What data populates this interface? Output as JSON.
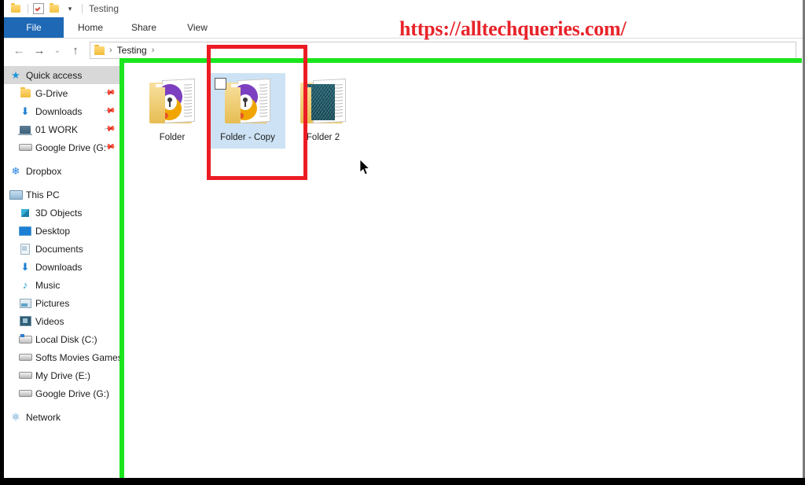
{
  "window": {
    "title": "Testing",
    "quick_access_toolbar": [
      {
        "name": "properties-folder-icon",
        "label": ""
      },
      {
        "name": "properties-checkbox-icon",
        "label": ""
      },
      {
        "name": "new-folder-icon",
        "label": ""
      },
      {
        "name": "customize-qat-caret",
        "label": "▾"
      }
    ]
  },
  "ribbon": {
    "tabs": [
      {
        "label": "File",
        "active": true
      },
      {
        "label": "Home",
        "active": false
      },
      {
        "label": "Share",
        "active": false
      },
      {
        "label": "View",
        "active": false
      }
    ]
  },
  "navigation": {
    "back_glyph": "←",
    "forward_glyph": "→",
    "recent_glyph": "⌄",
    "up_glyph": "↑",
    "breadcrumb": {
      "separator": "›",
      "leading_separator": "›",
      "crumbs": [
        "Testing"
      ]
    }
  },
  "sidebar": {
    "groups": [
      {
        "items": [
          {
            "label": "Quick access",
            "icon": "star-icon",
            "selected": true,
            "pinned": false,
            "indent": 0
          },
          {
            "label": "G-Drive",
            "icon": "folder-icon",
            "selected": false,
            "pinned": true,
            "indent": 1
          },
          {
            "label": "Downloads",
            "icon": "download-icon",
            "selected": false,
            "pinned": true,
            "indent": 1
          },
          {
            "label": "01 WORK",
            "icon": "laptop-icon",
            "selected": false,
            "pinned": true,
            "indent": 1
          },
          {
            "label": "Google Drive (G:",
            "icon": "drive-icon",
            "selected": false,
            "pinned": true,
            "indent": 1
          }
        ]
      },
      {
        "items": [
          {
            "label": "Dropbox",
            "icon": "dropbox-icon",
            "selected": false,
            "pinned": false,
            "indent": 0
          }
        ]
      },
      {
        "items": [
          {
            "label": "This PC",
            "icon": "this-pc-icon",
            "selected": false,
            "pinned": false,
            "indent": 0
          },
          {
            "label": "3D Objects",
            "icon": "3d-objects-icon",
            "selected": false,
            "pinned": false,
            "indent": 1
          },
          {
            "label": "Desktop",
            "icon": "desktop-icon",
            "selected": false,
            "pinned": false,
            "indent": 1
          },
          {
            "label": "Documents",
            "icon": "documents-icon",
            "selected": false,
            "pinned": false,
            "indent": 1
          },
          {
            "label": "Downloads",
            "icon": "download-icon",
            "selected": false,
            "pinned": false,
            "indent": 1
          },
          {
            "label": "Music",
            "icon": "music-icon",
            "selected": false,
            "pinned": false,
            "indent": 1
          },
          {
            "label": "Pictures",
            "icon": "pictures-icon",
            "selected": false,
            "pinned": false,
            "indent": 1
          },
          {
            "label": "Videos",
            "icon": "videos-icon",
            "selected": false,
            "pinned": false,
            "indent": 1
          },
          {
            "label": "Local Disk (C:)",
            "icon": "local-disk-icon",
            "selected": false,
            "pinned": false,
            "indent": 1
          },
          {
            "label": "Softs Movies Games",
            "icon": "drive-icon",
            "selected": false,
            "pinned": false,
            "indent": 1
          },
          {
            "label": "My Drive (E:)",
            "icon": "drive-icon",
            "selected": false,
            "pinned": false,
            "indent": 1
          },
          {
            "label": "Google Drive (G:)",
            "icon": "drive-icon",
            "selected": false,
            "pinned": false,
            "indent": 1
          }
        ]
      },
      {
        "items": [
          {
            "label": "Network",
            "icon": "network-icon",
            "selected": false,
            "pinned": false,
            "indent": 0
          }
        ]
      }
    ]
  },
  "content": {
    "items": [
      {
        "label": "Folder",
        "thumb": "swirl",
        "selected": false,
        "checkbox": false
      },
      {
        "label": "Folder - Copy",
        "thumb": "swirl",
        "selected": true,
        "checkbox": true
      },
      {
        "label": "Folder 2",
        "thumb": "teal",
        "selected": false,
        "checkbox": false
      }
    ]
  },
  "annotations": {
    "watermark_text": "https://alltechqueries.com/",
    "watermark_color": "#e8232a",
    "green_highlight_color": "#19e61e",
    "red_box_color": "#ec1c24"
  }
}
